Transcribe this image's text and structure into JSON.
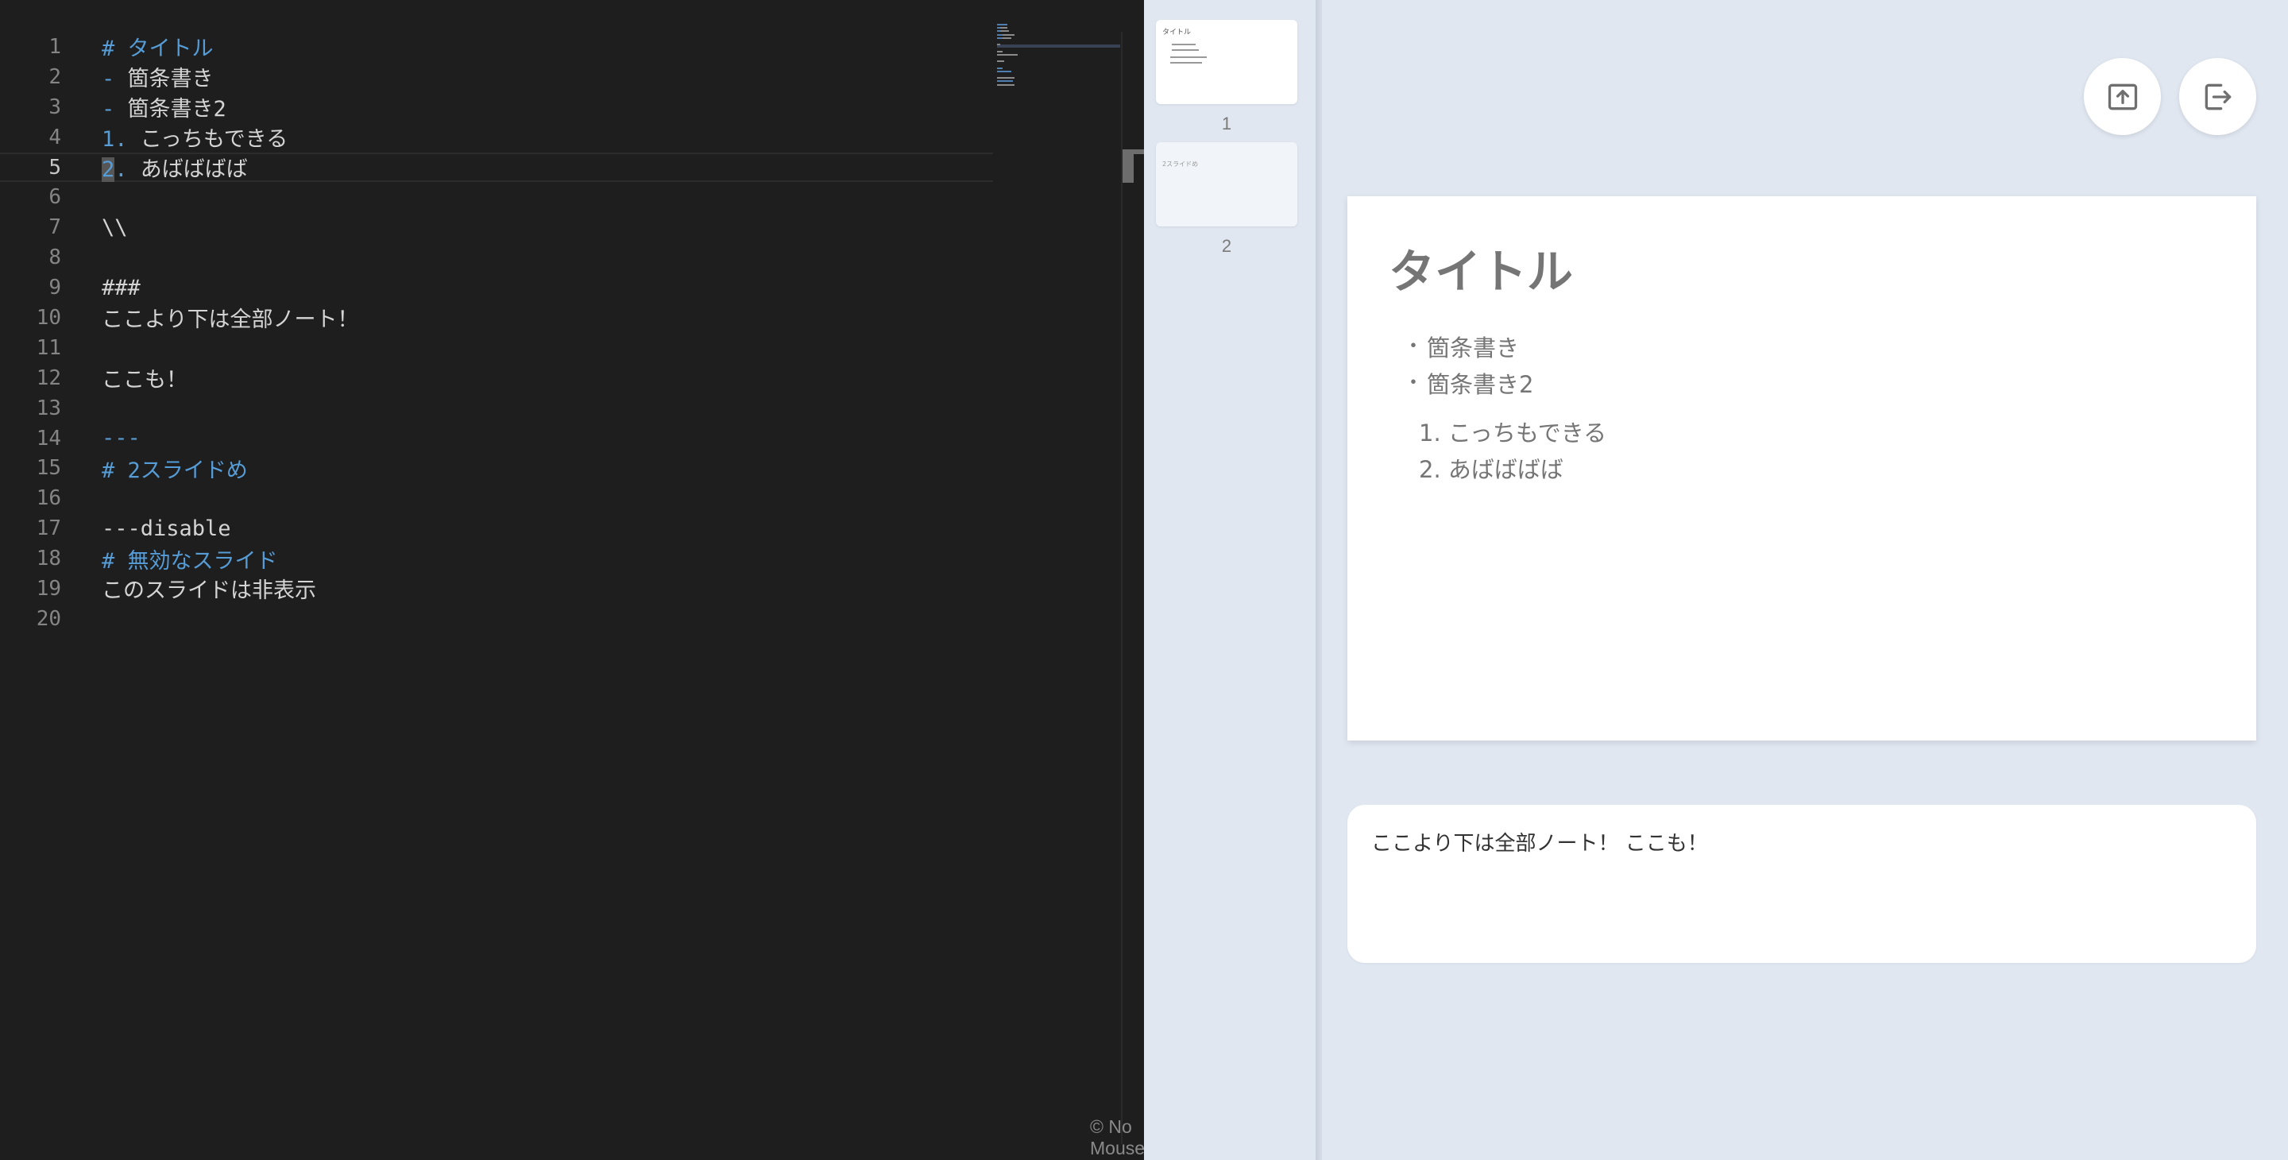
{
  "editor": {
    "lines": [
      {
        "n": "1",
        "tokens": [
          {
            "c": "md",
            "t": "# タイトル"
          }
        ]
      },
      {
        "n": "2",
        "tokens": [
          {
            "c": "md",
            "t": "- "
          },
          {
            "c": "tx",
            "t": "箇条書き"
          }
        ]
      },
      {
        "n": "3",
        "tokens": [
          {
            "c": "md",
            "t": "- "
          },
          {
            "c": "tx",
            "t": "箇条書き2"
          }
        ]
      },
      {
        "n": "4",
        "tokens": [
          {
            "c": "md",
            "t": "1. "
          },
          {
            "c": "tx",
            "t": "こっちもできる"
          }
        ]
      },
      {
        "n": "5",
        "current": true,
        "tokens": [
          {
            "c": "md cursor",
            "t": "2"
          },
          {
            "c": "md",
            "t": ". "
          },
          {
            "c": "tx",
            "t": "あばばばば"
          }
        ]
      },
      {
        "n": "6",
        "tokens": []
      },
      {
        "n": "7",
        "tokens": [
          {
            "c": "tx",
            "t": "\\\\"
          }
        ]
      },
      {
        "n": "8",
        "tokens": []
      },
      {
        "n": "9",
        "tokens": [
          {
            "c": "tx",
            "t": "###"
          }
        ]
      },
      {
        "n": "10",
        "tokens": [
          {
            "c": "tx",
            "t": "ここより下は全部ノート！"
          }
        ]
      },
      {
        "n": "11",
        "tokens": []
      },
      {
        "n": "12",
        "tokens": [
          {
            "c": "tx",
            "t": "ここも！"
          }
        ]
      },
      {
        "n": "13",
        "tokens": []
      },
      {
        "n": "14",
        "tokens": [
          {
            "c": "md",
            "t": "---"
          }
        ]
      },
      {
        "n": "15",
        "tokens": [
          {
            "c": "md",
            "t": "# 2スライドめ"
          }
        ]
      },
      {
        "n": "16",
        "tokens": []
      },
      {
        "n": "17",
        "tokens": [
          {
            "c": "tx",
            "t": "---disable"
          }
        ]
      },
      {
        "n": "18",
        "tokens": [
          {
            "c": "md",
            "t": "# 無効なスライド"
          }
        ]
      },
      {
        "n": "19",
        "tokens": [
          {
            "c": "tx",
            "t": "このスライドは非表示"
          }
        ]
      },
      {
        "n": "20",
        "tokens": []
      }
    ],
    "copyright": "© No Mouse"
  },
  "thumbnails": [
    {
      "number": "1",
      "title": "タイトル"
    },
    {
      "number": "2",
      "title": "2スライドめ"
    }
  ],
  "toolbar": {
    "upload_icon": "upload-icon",
    "exit_icon": "exit-icon"
  },
  "slide": {
    "title": "タイトル",
    "bullets": [
      "箇条書き",
      "箇条書き2"
    ],
    "numbered": [
      "1. こっちもできる",
      "2. あばばばば"
    ]
  },
  "notes": {
    "text": "ここより下は全部ノート！ ここも！"
  },
  "colors": {
    "editor_bg": "#1e1e1e",
    "markdown_accent": "#569cd6",
    "app_bg": "#e0e7f1"
  }
}
